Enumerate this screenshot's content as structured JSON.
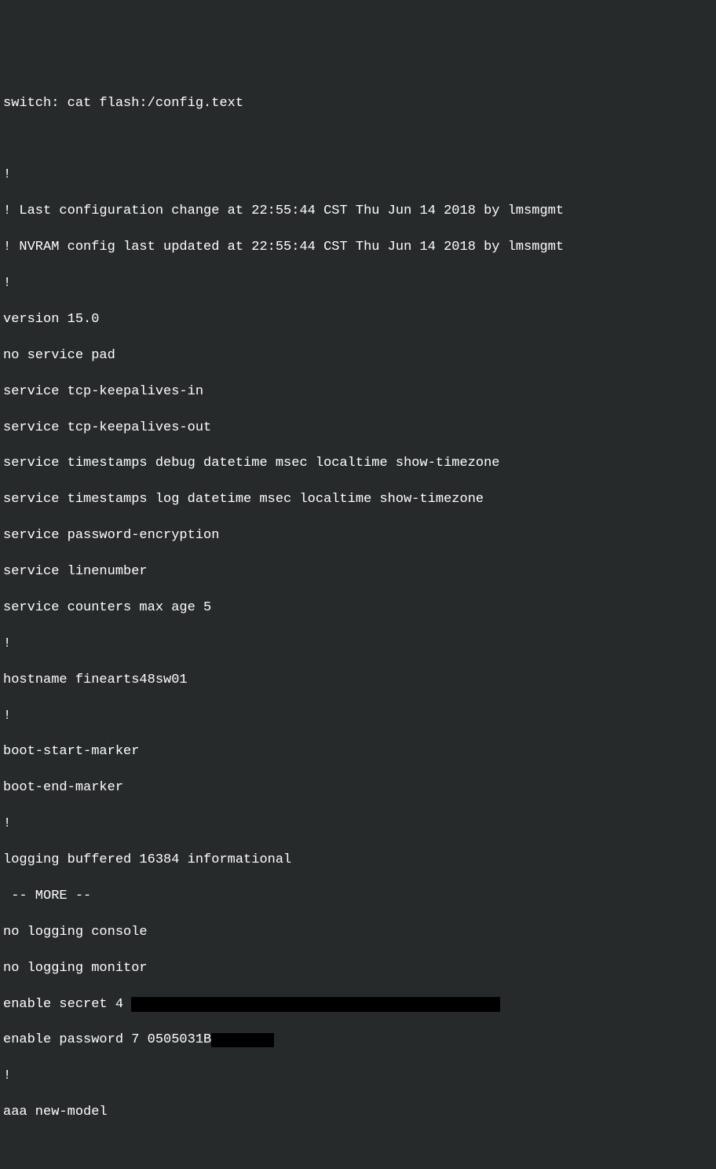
{
  "terminal": {
    "lines": [
      "switch: cat flash:/config.text",
      "",
      "!",
      "! Last configuration change at 22:55:44 CST Thu Jun 14 2018 by lmsmgmt",
      "! NVRAM config last updated at 22:55:44 CST Thu Jun 14 2018 by lmsmgmt",
      "!",
      "version 15.0",
      "no service pad",
      "service tcp-keepalives-in",
      "service tcp-keepalives-out",
      "service timestamps debug datetime msec localtime show-timezone",
      "service timestamps log datetime msec localtime show-timezone",
      "service password-encryption",
      "service linenumber",
      "service counters max age 5",
      "!",
      "hostname finearts48sw01",
      "!",
      "boot-start-marker",
      "boot-end-marker",
      "!",
      "logging buffered 16384 informational",
      " -- MORE --",
      "no logging console",
      "no logging monitor"
    ],
    "secret_prefix": "enable secret 4 ",
    "password_prefix": "enable password 7 0505031B",
    "trailing": [
      "!",
      "aaa new-model"
    ]
  }
}
